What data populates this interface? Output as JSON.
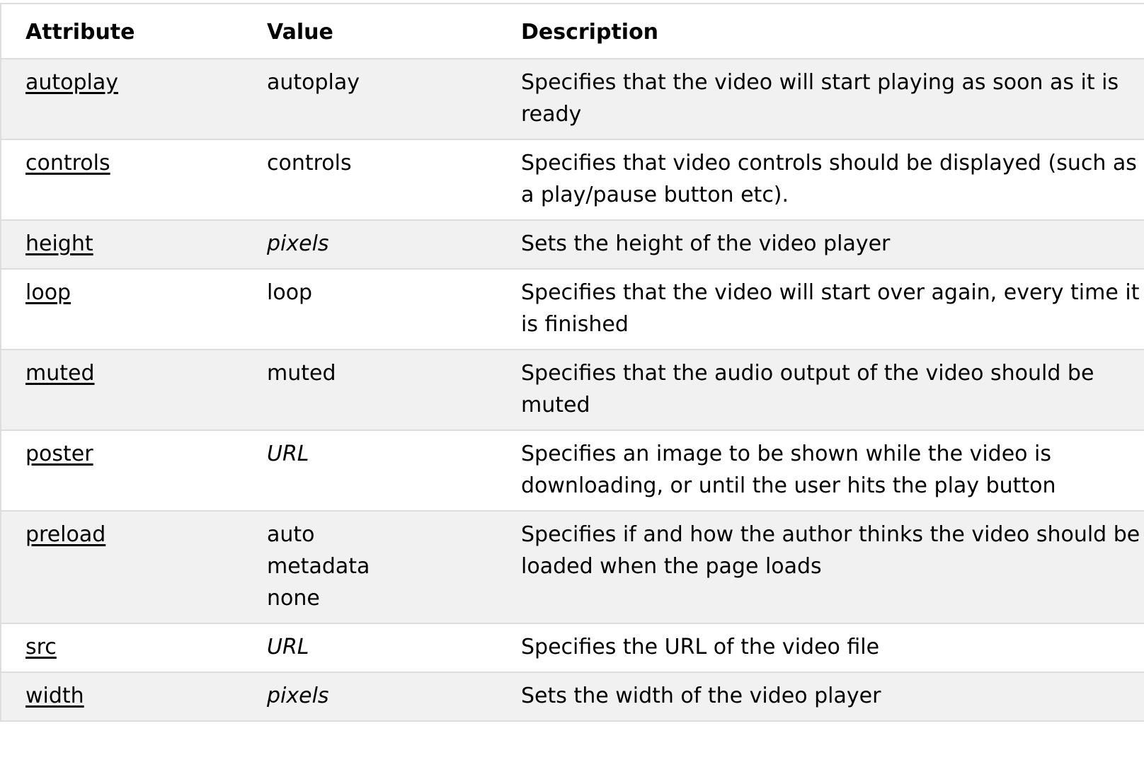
{
  "headers": [
    "Attribute",
    "Value",
    "Description"
  ],
  "rows": [
    {
      "attribute": "autoplay",
      "values": [
        "autoplay"
      ],
      "italic": false,
      "description": "Specifies that the video will start playing as soon as it is ready"
    },
    {
      "attribute": "controls",
      "values": [
        "controls"
      ],
      "italic": false,
      "description": "Specifies that video controls should be displayed (such as a play/pause button etc)."
    },
    {
      "attribute": "height",
      "values": [
        "pixels"
      ],
      "italic": true,
      "description": "Sets the height of the video player"
    },
    {
      "attribute": "loop",
      "values": [
        "loop"
      ],
      "italic": false,
      "description": "Specifies that the video will start over again, every time it is finished"
    },
    {
      "attribute": "muted",
      "values": [
        "muted"
      ],
      "italic": false,
      "description": "Specifies that the audio output of the video should be muted"
    },
    {
      "attribute": "poster",
      "values": [
        "URL"
      ],
      "italic": true,
      "description": "Specifies an image to be shown while the video is downloading, or until the user hits the play button"
    },
    {
      "attribute": "preload",
      "values": [
        "auto",
        "metadata",
        "none"
      ],
      "italic": false,
      "description": "Specifies if and how the author thinks the video should be loaded when the page loads"
    },
    {
      "attribute": "src",
      "values": [
        "URL"
      ],
      "italic": true,
      "description": "Specifies the URL of the video file"
    },
    {
      "attribute": "width",
      "values": [
        "pixels"
      ],
      "italic": true,
      "description": "Sets the width of the video player"
    }
  ]
}
